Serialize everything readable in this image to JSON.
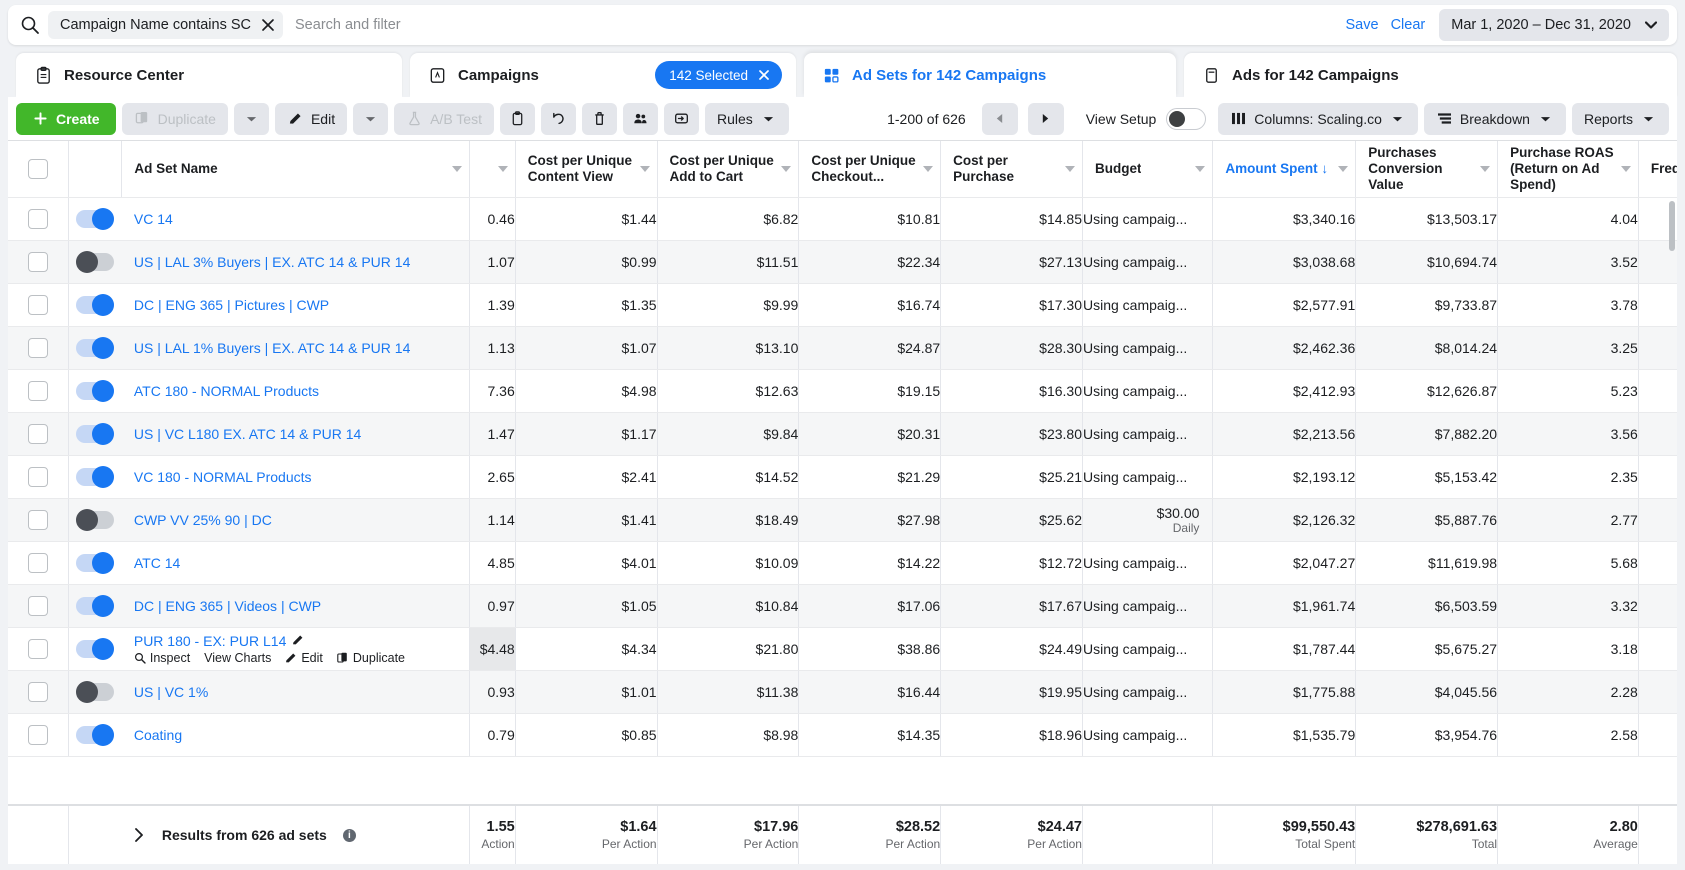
{
  "search": {
    "filter_chip": "Campaign Name contains SC",
    "placeholder": "Search and filter",
    "save_label": "Save",
    "clear_label": "Clear",
    "date_range": "Mar 1, 2020 – Dec 31, 2020"
  },
  "tabs": [
    {
      "label": "Resource Center",
      "icon": "clipboard-icon",
      "active": false
    },
    {
      "label": "Campaigns",
      "icon": "campaign-icon",
      "active": false,
      "badge": "142 Selected"
    },
    {
      "label": "Ad Sets for 142 Campaigns",
      "icon": "adsets-icon",
      "active": true
    },
    {
      "label": "Ads for 142 Campaigns",
      "icon": "ads-icon",
      "active": false
    }
  ],
  "toolbar": {
    "create": "Create",
    "duplicate": "Duplicate",
    "edit": "Edit",
    "ab_test": "A/B Test",
    "rules": "Rules",
    "page_count": "1-200 of 626",
    "view_setup": "View Setup",
    "columns": "Columns: Scaling.co",
    "breakdown": "Breakdown",
    "reports": "Reports"
  },
  "table": {
    "columns": [
      {
        "key": "name",
        "label": "Ad Set Name"
      },
      {
        "key": "cpucv",
        "label": "Cost per Unique Content View"
      },
      {
        "key": "cpuatc",
        "label": "Cost per Unique Add to Cart"
      },
      {
        "key": "cpuco",
        "label": "Cost per Unique Checkout..."
      },
      {
        "key": "cpp",
        "label": "Cost per Purchase"
      },
      {
        "key": "budget",
        "label": "Budget"
      },
      {
        "key": "spent",
        "label": "Amount Spent",
        "sorted": "desc"
      },
      {
        "key": "pcv",
        "label": "Purchases Conversion Value"
      },
      {
        "key": "roas",
        "label": "Purchase ROAS (Return on Ad Spend)"
      },
      {
        "key": "freq",
        "label": "Frequen"
      }
    ],
    "rows": [
      {
        "name": "VC 14",
        "toggle": "on",
        "clipped": "0.46",
        "cpucv": "$1.44",
        "cpuatc": "$6.82",
        "cpuco": "$10.81",
        "cpp": "$14.85",
        "budget": "Using campaig...",
        "spent": "$3,340.16",
        "pcv": "$13,503.17",
        "roas": "4.04"
      },
      {
        "name": "US | LAL 3% Buyers | EX. ATC 14 & PUR 14",
        "toggle": "off",
        "clipped": "1.07",
        "cpucv": "$0.99",
        "cpuatc": "$11.51",
        "cpuco": "$22.34",
        "cpp": "$27.13",
        "budget": "Using campaig...",
        "spent": "$3,038.68",
        "pcv": "$10,694.74",
        "roas": "3.52"
      },
      {
        "name": "DC | ENG 365 | Pictures | CWP",
        "toggle": "on",
        "clipped": "1.39",
        "cpucv": "$1.35",
        "cpuatc": "$9.99",
        "cpuco": "$16.74",
        "cpp": "$17.30",
        "budget": "Using campaig...",
        "spent": "$2,577.91",
        "pcv": "$9,733.87",
        "roas": "3.78"
      },
      {
        "name": "US | LAL 1% Buyers | EX. ATC 14 & PUR 14",
        "toggle": "on",
        "clipped": "1.13",
        "cpucv": "$1.07",
        "cpuatc": "$13.10",
        "cpuco": "$24.87",
        "cpp": "$28.30",
        "budget": "Using campaig...",
        "spent": "$2,462.36",
        "pcv": "$8,014.24",
        "roas": "3.25"
      },
      {
        "name": "ATC 180 - NORMAL Products",
        "toggle": "on",
        "clipped": "7.36",
        "cpucv": "$4.98",
        "cpuatc": "$12.63",
        "cpuco": "$19.15",
        "cpp": "$16.30",
        "budget": "Using campaig...",
        "spent": "$2,412.93",
        "pcv": "$12,626.87",
        "roas": "5.23"
      },
      {
        "name": "US | VC L180 EX. ATC 14 & PUR 14",
        "toggle": "on",
        "clipped": "1.47",
        "cpucv": "$1.17",
        "cpuatc": "$9.84",
        "cpuco": "$20.31",
        "cpp": "$23.80",
        "budget": "Using campaig...",
        "spent": "$2,213.56",
        "pcv": "$7,882.20",
        "roas": "3.56"
      },
      {
        "name": "VC 180 - NORMAL Products",
        "toggle": "on",
        "clipped": "2.65",
        "cpucv": "$2.41",
        "cpuatc": "$14.52",
        "cpuco": "$21.29",
        "cpp": "$25.21",
        "budget": "Using campaig...",
        "spent": "$2,193.12",
        "pcv": "$5,153.42",
        "roas": "2.35"
      },
      {
        "name": "CWP VV 25% 90 | DC",
        "toggle": "off",
        "clipped": "1.14",
        "cpucv": "$1.41",
        "cpuatc": "$18.49",
        "cpuco": "$27.98",
        "cpp": "$25.62",
        "budget": "$30.00",
        "budget_sub": "Daily",
        "spent": "$2,126.32",
        "pcv": "$5,887.76",
        "roas": "2.77"
      },
      {
        "name": "ATC 14",
        "toggle": "on",
        "clipped": "4.85",
        "cpucv": "$4.01",
        "cpuatc": "$10.09",
        "cpuco": "$14.22",
        "cpp": "$12.72",
        "budget": "Using campaig...",
        "spent": "$2,047.27",
        "pcv": "$11,619.98",
        "roas": "5.68"
      },
      {
        "name": "DC | ENG 365 | Videos | CWP",
        "toggle": "on",
        "clipped": "0.97",
        "cpucv": "$1.05",
        "cpuatc": "$10.84",
        "cpuco": "$17.06",
        "cpp": "$17.67",
        "budget": "Using campaig...",
        "spent": "$1,961.74",
        "pcv": "$6,503.59",
        "roas": "3.32"
      },
      {
        "name": "PUR 180 - EX: PUR L14",
        "toggle": "on",
        "hovered": true,
        "editable": true,
        "clipped": "$4.48",
        "cpucv": "$4.34",
        "cpuatc": "$21.80",
        "cpuco": "$38.86",
        "cpp": "$24.49",
        "budget": "Using campaig...",
        "spent": "$1,787.44",
        "pcv": "$5,675.27",
        "roas": "3.18",
        "actions": [
          {
            "label": "Inspect",
            "icon": "magnifier-icon"
          },
          {
            "label": "View Charts",
            "icon": "chart-icon"
          },
          {
            "label": "Edit",
            "icon": "pencil-icon"
          },
          {
            "label": "Duplicate",
            "icon": "duplicate-icon"
          }
        ]
      },
      {
        "name": "US | VC 1%",
        "toggle": "off",
        "clipped": "0.93",
        "cpucv": "$1.01",
        "cpuatc": "$11.38",
        "cpuco": "$16.44",
        "cpp": "$19.95",
        "budget": "Using campaig...",
        "spent": "$1,775.88",
        "pcv": "$4,045.56",
        "roas": "2.28"
      },
      {
        "name": "Coating",
        "toggle": "on",
        "clipped": "0.79",
        "cpucv": "$0.85",
        "cpuatc": "$8.98",
        "cpuco": "$14.35",
        "cpp": "$18.96",
        "budget": "Using campaig...",
        "spent": "$1,535.79",
        "pcv": "$3,954.76",
        "roas": "2.58"
      }
    ],
    "footer": {
      "label": "Results from 626 ad sets",
      "clipped": "1.55",
      "clipped_sub": "Action",
      "cpucv": "$1.64",
      "cpucv_sub": "Per Action",
      "cpuatc": "$17.96",
      "cpuatc_sub": "Per Action",
      "cpuco": "$28.52",
      "cpuco_sub": "Per Action",
      "cpp": "$24.47",
      "cpp_sub": "Per Action",
      "budget": "",
      "spent": "$99,550.43",
      "spent_sub": "Total Spent",
      "pcv": "$278,691.63",
      "pcv_sub": "Total",
      "roas": "2.80",
      "roas_sub": "Average"
    }
  },
  "colors": {
    "accent": "#1877f2",
    "create_green": "#42b72a",
    "row_alt": "#f5f6f7"
  }
}
